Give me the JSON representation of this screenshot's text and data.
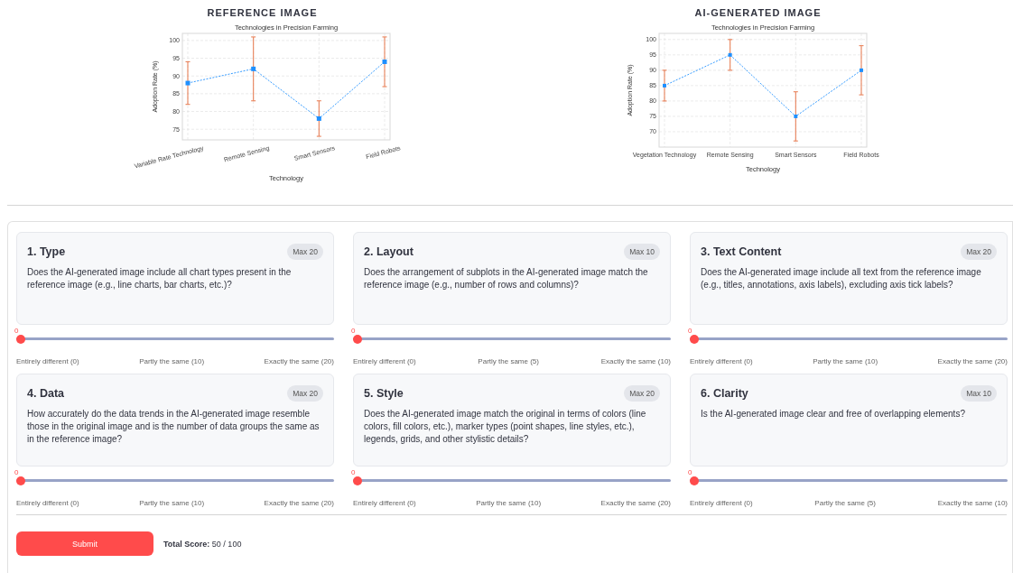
{
  "images": [
    {
      "heading": "REFERENCE IMAGE",
      "chart_data": {
        "type": "line",
        "title": "Technologies in Precision Farming",
        "xlabel": "Technology",
        "ylabel": "Adoption Rate (%)",
        "categories": [
          "Variable Rate Technology",
          "Remote Sensing",
          "Smart Sensors",
          "Field Robots"
        ],
        "ylim": [
          72,
          102
        ],
        "yticks": [
          75,
          80,
          85,
          90,
          95,
          100
        ],
        "grid": true,
        "series": [
          {
            "color": "#1e90ff",
            "line_style": "dashed",
            "marker": "square",
            "values": [
              88,
              92,
              78,
              94
            ],
            "errors": [
              6,
              9,
              5,
              7
            ]
          }
        ]
      }
    },
    {
      "heading": "AI-GENERATED IMAGE",
      "chart_data": {
        "type": "line",
        "title": "Technologies in Precision Farming",
        "xlabel": "Technology",
        "ylabel": "Adoption Rate (%)",
        "categories": [
          "Vegetation Technology",
          "Remote Sensing",
          "Smart Sensors",
          "Field Robots"
        ],
        "ylim": [
          65,
          102
        ],
        "yticks": [
          70,
          75,
          80,
          85,
          90,
          95,
          100
        ],
        "grid": true,
        "series": [
          {
            "color": "#1e90ff",
            "line_style": "dashed",
            "marker": "square",
            "values": [
              85,
              95,
              75,
              90
            ],
            "errors": [
              5,
              5,
              8,
              8
            ]
          }
        ]
      }
    }
  ],
  "criteria": [
    {
      "title": "1. Type",
      "max": "Max 20",
      "question": "Does the AI-generated image include all chart types present in the reference image (e.g., line charts, bar charts, etc.)?",
      "value": "0",
      "level": 0,
      "scale": [
        "Entirely different (0)",
        "Partly the same (10)",
        "Exactly the same (20)"
      ]
    },
    {
      "title": "2. Layout",
      "max": "Max 10",
      "question": "Does the arrangement of subplots in the AI-generated image match the reference image (e.g., number of rows and columns)?",
      "value": "0",
      "level": 0,
      "scale": [
        "Entirely different (0)",
        "Partly the same (5)",
        "Exactly the same (10)"
      ]
    },
    {
      "title": "3. Text Content",
      "max": "Max 20",
      "question": "Does the AI-generated image include all text from the reference image (e.g., titles, annotations, axis labels), excluding axis tick labels?",
      "value": "0",
      "level": 0,
      "scale": [
        "Entirely different (0)",
        "Partly the same (10)",
        "Exactly the same (20)"
      ]
    },
    {
      "title": "4. Data",
      "max": "Max 20",
      "question": "How accurately do the data trends in the AI-generated image resemble those in the original image and is the number of data groups the same as in the reference image?",
      "value": "0",
      "level": 0,
      "scale": [
        "Entirely different (0)",
        "Partly the same (10)",
        "Exactly the same (20)"
      ]
    },
    {
      "title": "5. Style",
      "max": "Max 20",
      "question": "Does the AI-generated image match the original in terms of colors (line colors, fill colors, etc.), marker types (point shapes, line styles, etc.), legends, grids, and other stylistic details?",
      "value": "0",
      "level": 0,
      "scale": [
        "Entirely different (0)",
        "Partly the same (10)",
        "Exactly the same (20)"
      ]
    },
    {
      "title": "6. Clarity",
      "max": "Max 10",
      "question": "Is the AI-generated image clear and free of overlapping elements?",
      "value": "0",
      "level": 0,
      "scale": [
        "Entirely different (0)",
        "Partly the same (5)",
        "Exactly the same (10)"
      ]
    }
  ],
  "submit": "Submit",
  "total": {
    "label": "Total Score:",
    "value": "50 / 100"
  }
}
